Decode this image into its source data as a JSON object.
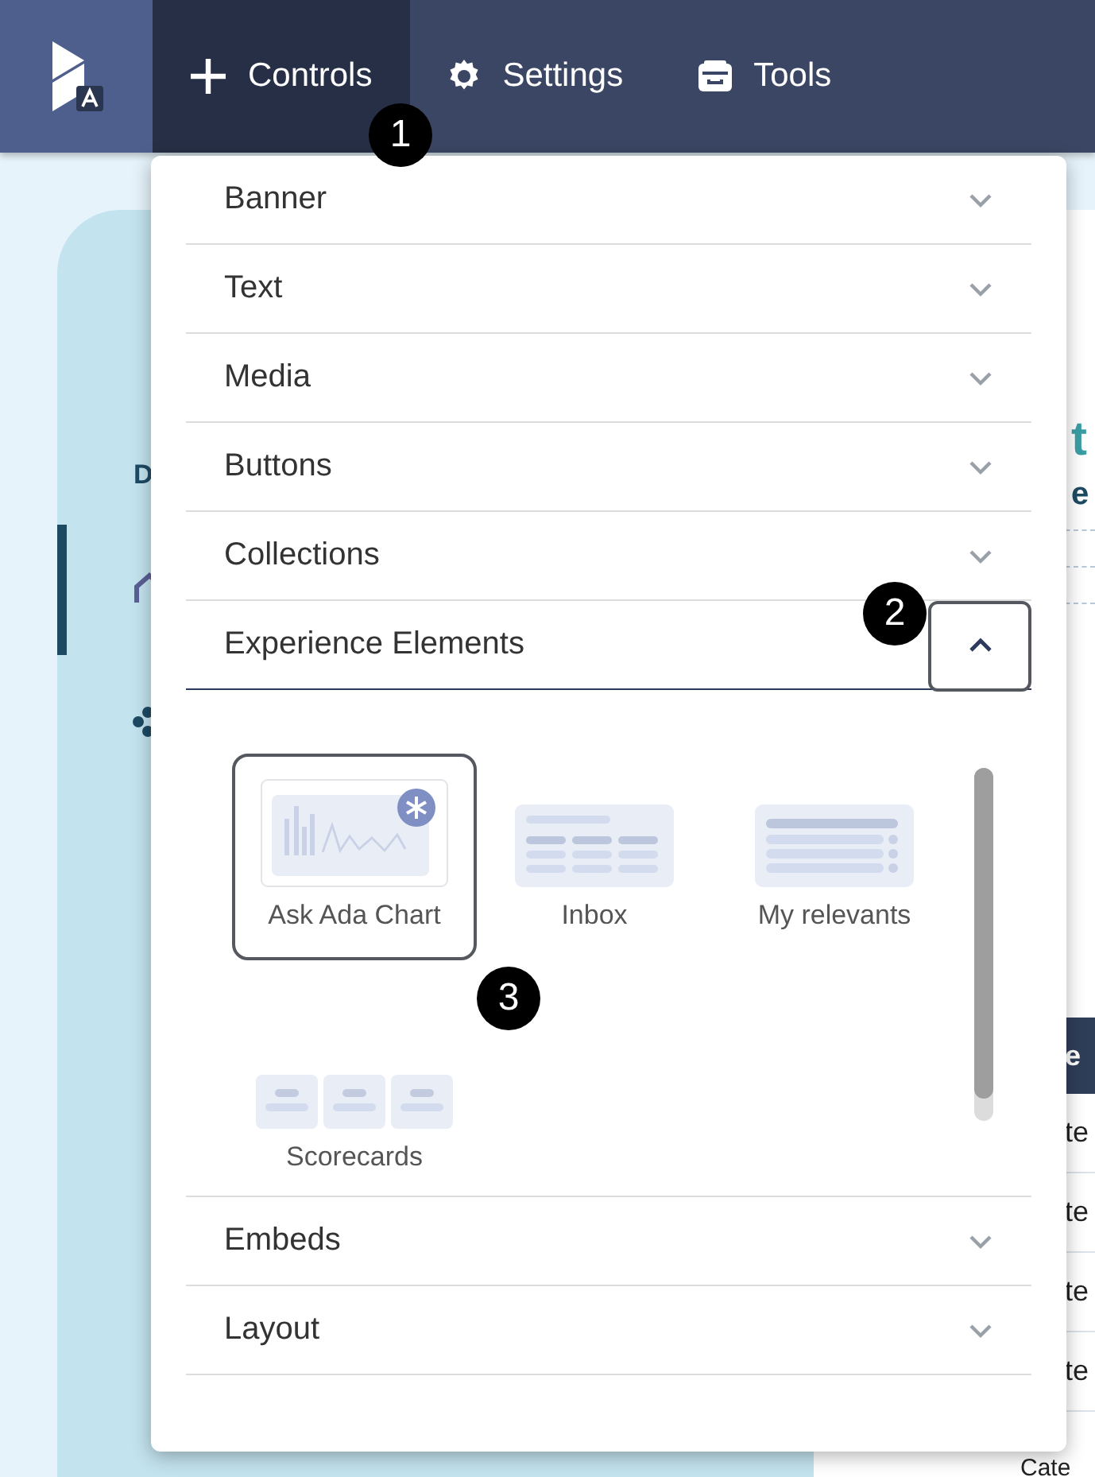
{
  "nav": {
    "items": [
      {
        "label": "Controls",
        "selected": true
      },
      {
        "label": "Settings",
        "selected": false
      },
      {
        "label": "Tools",
        "selected": false
      }
    ]
  },
  "callouts": [
    "1",
    "2",
    "3"
  ],
  "background": {
    "sidebar_fragment": "D",
    "heading_fragment": "t",
    "subheading_fragment": "e",
    "table_header_fragment": "e",
    "table_cells": [
      "te",
      "te",
      "te",
      "te",
      "Cate"
    ]
  },
  "menu": {
    "sections": [
      {
        "title": "Banner",
        "expanded": false
      },
      {
        "title": "Text",
        "expanded": false
      },
      {
        "title": "Media",
        "expanded": false
      },
      {
        "title": "Buttons",
        "expanded": false
      },
      {
        "title": "Collections",
        "expanded": false
      },
      {
        "title": "Experience Elements",
        "expanded": true,
        "elements": [
          {
            "label": "Ask Ada Chart",
            "kind": "chart",
            "selected": true
          },
          {
            "label": "Inbox",
            "kind": "table",
            "selected": false
          },
          {
            "label": "My relevants",
            "kind": "list",
            "selected": false
          },
          {
            "label": "Scorecards",
            "kind": "scorecards",
            "selected": false
          }
        ]
      },
      {
        "title": "Embeds",
        "expanded": false
      },
      {
        "title": "Layout",
        "expanded": false
      }
    ]
  }
}
